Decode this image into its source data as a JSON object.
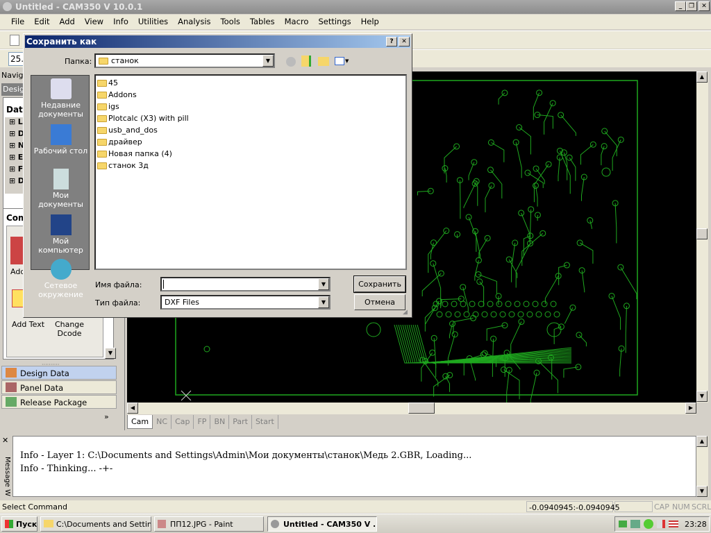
{
  "window": {
    "title": "Untitled - CAM350 V 10.0.1"
  },
  "menu": [
    "File",
    "Edit",
    "Add",
    "View",
    "Info",
    "Utilities",
    "Analysis",
    "Tools",
    "Tables",
    "Macro",
    "Settings",
    "Help"
  ],
  "toolbar": {
    "zoom_value": "25."
  },
  "left_panel": {
    "navigator_label": "Naviga",
    "design_tab": "Desig",
    "data_header": "Data",
    "commands_header": "Com",
    "tree_items": [
      "L",
      "D",
      "N",
      "E",
      "F",
      "D"
    ],
    "commands": [
      {
        "label": "Add",
        "icon": "add-icon"
      },
      {
        "label": "Add Text",
        "icon": "add-text-icon"
      },
      {
        "label": "Change Dcode",
        "icon": "change-dcode-icon"
      }
    ],
    "nav_items": [
      {
        "label": "Design Data",
        "icon": "design-data-icon",
        "active": true
      },
      {
        "label": "Panel Data",
        "icon": "panel-data-icon"
      },
      {
        "label": "Release Package",
        "icon": "release-package-icon"
      }
    ],
    "more": "»"
  },
  "tabs": [
    {
      "label": "Cam",
      "active": true
    },
    {
      "label": "NC"
    },
    {
      "label": "Cap"
    },
    {
      "label": "FP"
    },
    {
      "label": "BN"
    },
    {
      "label": "Part"
    },
    {
      "label": "Start"
    }
  ],
  "message_window": {
    "label": "Message W",
    "lines": [
      "Info - Layer 1: C:\\Documents and Settings\\Admin\\Мои документы\\станок\\Медь 2.GBR, Loading...",
      "Info - Thinking... -+-"
    ]
  },
  "status": {
    "command": "Select Command",
    "coords": "-0.0940945:-0.0940945",
    "cap": "CAP",
    "num": "NUM",
    "scrl": "SCRL"
  },
  "taskbar": {
    "start": "Пуск",
    "tasks": [
      "C:\\Documents and Settin...",
      "ПП12.JPG - Paint",
      "Untitled - CAM350 V ..."
    ],
    "clock": "23:28"
  },
  "dialog": {
    "title": "Сохранить как",
    "folder_label": "Папка:",
    "folder_value": "станок",
    "places": [
      "Недавние документы",
      "Рабочий стол",
      "Мои документы",
      "Мой компьютер",
      "Сетевое окружение"
    ],
    "files": [
      "45",
      "Addons",
      "igs",
      "Plotcalc (X3) with pill",
      "usb_and_dos",
      "драйвер",
      "Новая папка (4)",
      "станок 3д"
    ],
    "filename_label": "Имя файла:",
    "filename_value": "",
    "filetype_label": "Тип файла:",
    "filetype_value": "DXF Files",
    "save": "Сохранить",
    "cancel": "Отмена"
  },
  "colors": {
    "pcb_trace": "#1fa81f",
    "canvas_bg": "#000000",
    "dialog_title": "#0a246a"
  }
}
